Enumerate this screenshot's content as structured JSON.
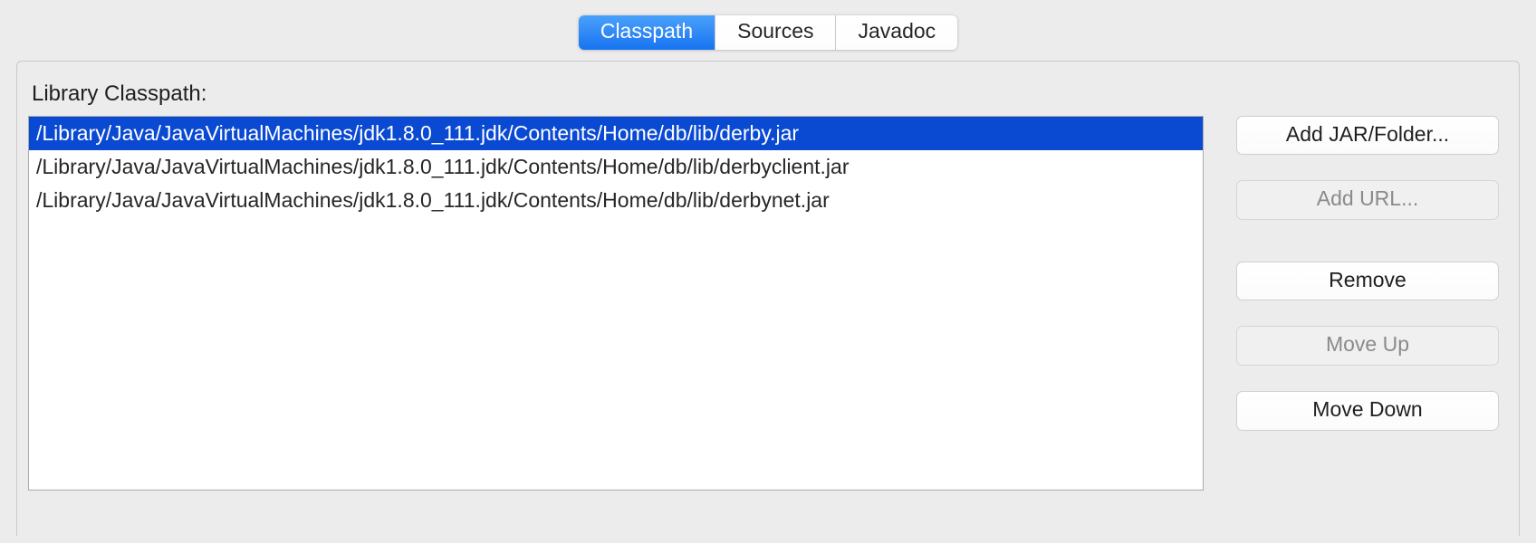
{
  "tabs": {
    "classpath": "Classpath",
    "sources": "Sources",
    "javadoc": "Javadoc"
  },
  "panel": {
    "label": "Library Classpath:"
  },
  "classpath_entries": [
    "/Library/Java/JavaVirtualMachines/jdk1.8.0_111.jdk/Contents/Home/db/lib/derby.jar",
    "/Library/Java/JavaVirtualMachines/jdk1.8.0_111.jdk/Contents/Home/db/lib/derbyclient.jar",
    "/Library/Java/JavaVirtualMachines/jdk1.8.0_111.jdk/Contents/Home/db/lib/derbynet.jar"
  ],
  "buttons": {
    "add_jar": "Add JAR/Folder...",
    "add_url": "Add URL...",
    "remove": "Remove",
    "move_up": "Move Up",
    "move_down": "Move Down"
  },
  "selected_index": 0
}
